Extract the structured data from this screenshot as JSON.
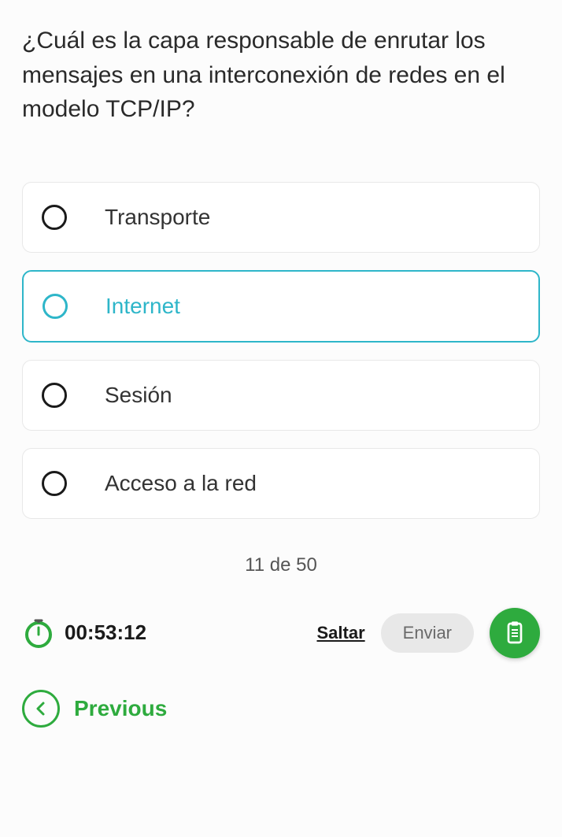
{
  "question": "¿Cuál es la capa responsable de enrutar los mensajes en una interconexión de redes en el modelo TCP/IP?",
  "options": [
    {
      "label": "Transporte",
      "selected": false
    },
    {
      "label": "Internet",
      "selected": true
    },
    {
      "label": "Sesión",
      "selected": false
    },
    {
      "label": "Acceso a la red",
      "selected": false
    }
  ],
  "progress": "11 de 50",
  "timer": "00:53:12",
  "actions": {
    "skip_label": "Saltar",
    "submit_label": "Enviar"
  },
  "nav": {
    "previous_label": "Previous"
  },
  "colors": {
    "accent_teal": "#2eb6c9",
    "accent_green": "#2eab3e"
  }
}
